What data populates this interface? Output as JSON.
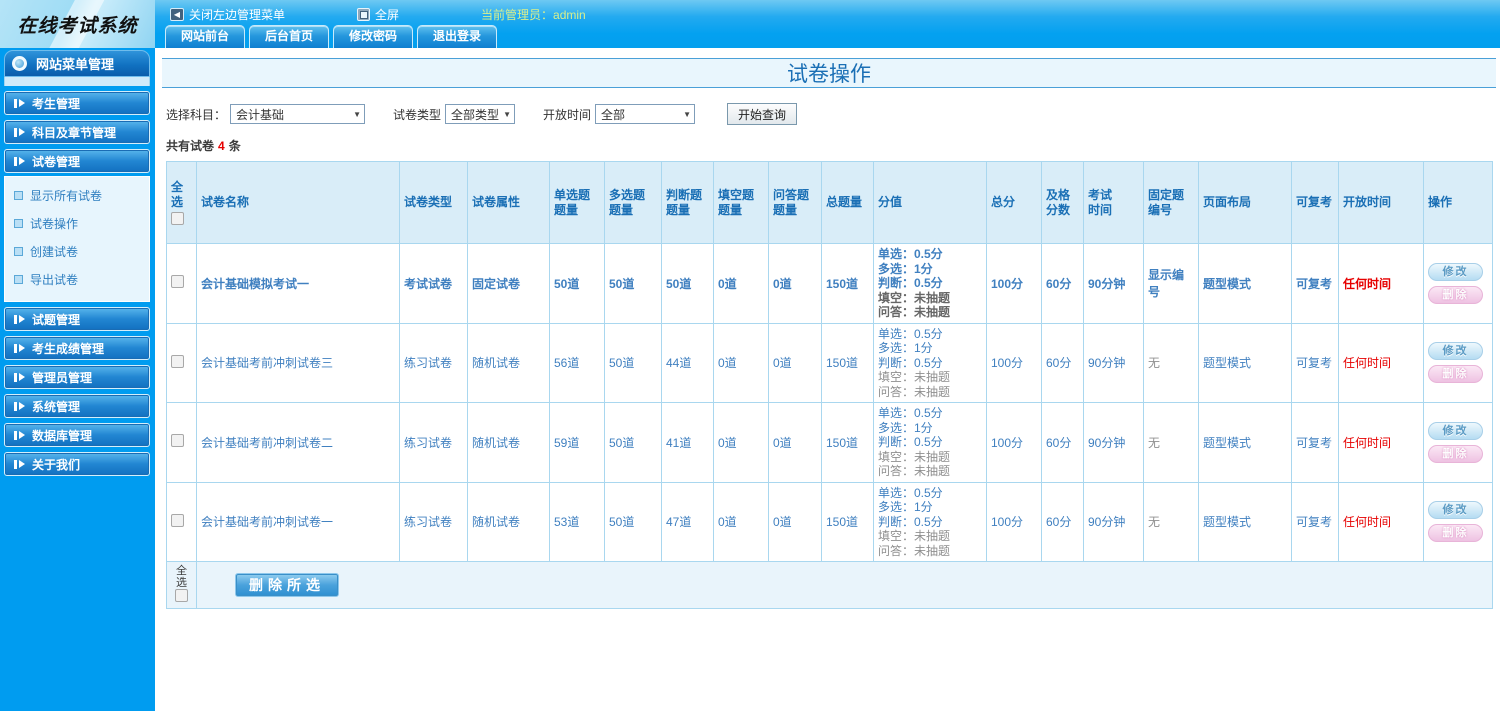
{
  "topbar": {
    "logo": "在线考试系统",
    "close_menu_label": "关闭左边管理菜单",
    "fullscreen_label": "全屏",
    "admin_label": "当前管理员：",
    "admin_name": "admin",
    "tabs": [
      "网站前台",
      "后台首页",
      "修改密码",
      "退出登录"
    ]
  },
  "sidebar": {
    "header": "网站菜单管理",
    "items": [
      "考生管理",
      "科目及章节管理",
      "试卷管理",
      "试题管理",
      "考生成绩管理",
      "管理员管理",
      "系统管理",
      "数据库管理",
      "关于我们"
    ],
    "submenu_parent": "试卷管理",
    "submenu": [
      "显示所有试卷",
      "试卷操作",
      "创建试卷",
      "导出试卷"
    ]
  },
  "main": {
    "title": "试卷操作",
    "filters": {
      "subject_label": "选择科目：",
      "subject_value": "会计基础",
      "type_label": "试卷类型",
      "type_value": "全部类型",
      "open_label": "开放时间",
      "open_value": "全部",
      "query_button": "开始查询"
    },
    "count": {
      "prefix": "共有试卷",
      "value": "4",
      "suffix": "条"
    },
    "table": {
      "headers": [
        "全选",
        "试卷名称",
        "试卷类型",
        "试卷属性",
        "单选题\n题量",
        "多选题\n题量",
        "判断题\n题量",
        "填空题\n题量",
        "问答题\n题量",
        "总题量",
        "分值",
        "总分",
        "及格\n分数",
        "考试\n时间",
        "固定题\n编号",
        "页面布局",
        "可复考",
        "开放时间",
        "操作"
      ],
      "actions": {
        "edit": "修改",
        "delete": "删除"
      },
      "rows": [
        {
          "name": "会计基础模拟考试一",
          "type": "考试试卷",
          "attr": "固定试卷",
          "single": "50道",
          "multi": "50道",
          "judge": "50道",
          "blank": "0道",
          "qa": "0道",
          "total_q": "150道",
          "score_lines": [
            "单选：0.5分",
            "多选：1分",
            "判断：0.5分",
            "填空：未抽题",
            "问答：未抽题"
          ],
          "total_score": "100分",
          "pass_score": "60分",
          "duration": "90分钟",
          "fixed_no": "显示编号",
          "layout": "题型模式",
          "retake": "可复考",
          "open_time": "任何时间",
          "bold": true
        },
        {
          "name": "会计基础考前冲刺试卷三",
          "type": "练习试卷",
          "attr": "随机试卷",
          "single": "56道",
          "multi": "50道",
          "judge": "44道",
          "blank": "0道",
          "qa": "0道",
          "total_q": "150道",
          "score_lines": [
            "单选：0.5分",
            "多选：1分",
            "判断：0.5分",
            "填空：未抽题",
            "问答：未抽题"
          ],
          "total_score": "100分",
          "pass_score": "60分",
          "duration": "90分钟",
          "fixed_no": "无",
          "layout": "题型模式",
          "retake": "可复考",
          "open_time": "任何时间",
          "bold": false
        },
        {
          "name": "会计基础考前冲刺试卷二",
          "type": "练习试卷",
          "attr": "随机试卷",
          "single": "59道",
          "multi": "50道",
          "judge": "41道",
          "blank": "0道",
          "qa": "0道",
          "total_q": "150道",
          "score_lines": [
            "单选：0.5分",
            "多选：1分",
            "判断：0.5分",
            "填空：未抽题",
            "问答：未抽题"
          ],
          "total_score": "100分",
          "pass_score": "60分",
          "duration": "90分钟",
          "fixed_no": "无",
          "layout": "题型模式",
          "retake": "可复考",
          "open_time": "任何时间",
          "bold": false
        },
        {
          "name": "会计基础考前冲刺试卷一",
          "type": "练习试卷",
          "attr": "随机试卷",
          "single": "53道",
          "multi": "50道",
          "judge": "47道",
          "blank": "0道",
          "qa": "0道",
          "total_q": "150道",
          "score_lines": [
            "单选：0.5分",
            "多选：1分",
            "判断：0.5分",
            "填空：未抽题",
            "问答：未抽题"
          ],
          "total_score": "100分",
          "pass_score": "60分",
          "duration": "90分钟",
          "fixed_no": "无",
          "layout": "题型模式",
          "retake": "可复考",
          "open_time": "任何时间",
          "bold": false
        }
      ],
      "footer": {
        "select_all": "全选",
        "delete_selected": "删除所选"
      }
    }
  },
  "colors": {
    "sidebar_blue": "#009cf0",
    "header_bg": "#d9edf8",
    "link_blue": "#4080c0",
    "bold_blue": "#155a9e",
    "alert_red": "#e60000"
  }
}
